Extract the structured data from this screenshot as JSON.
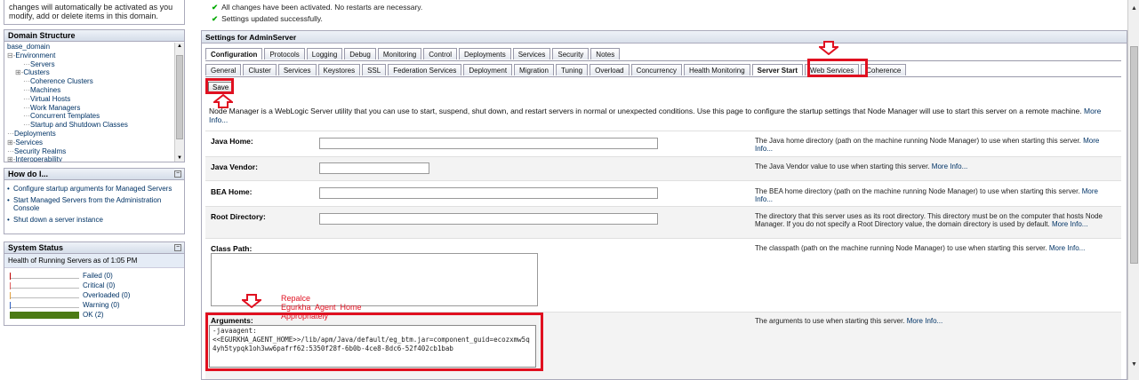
{
  "left": {
    "change_msg": "changes will automatically be activated as you modify, add or delete items in this domain.",
    "domain_structure": {
      "title": "Domain Structure",
      "items": [
        {
          "label": "base_domain",
          "indent": 0,
          "prefix": ""
        },
        {
          "label": "Environment",
          "indent": 0,
          "prefix": "⊟-"
        },
        {
          "label": "Servers",
          "indent": 2,
          "prefix": "···"
        },
        {
          "label": "Clusters",
          "indent": 1,
          "prefix": "⊞-"
        },
        {
          "label": "Coherence Clusters",
          "indent": 2,
          "prefix": "···"
        },
        {
          "label": "Machines",
          "indent": 2,
          "prefix": "···"
        },
        {
          "label": "Virtual Hosts",
          "indent": 2,
          "prefix": "···"
        },
        {
          "label": "Work Managers",
          "indent": 2,
          "prefix": "···"
        },
        {
          "label": "Concurrent Templates",
          "indent": 2,
          "prefix": "···"
        },
        {
          "label": "Startup and Shutdown Classes",
          "indent": 2,
          "prefix": "···"
        },
        {
          "label": "Deployments",
          "indent": 0,
          "prefix": "···"
        },
        {
          "label": "Services",
          "indent": 0,
          "prefix": "⊞-"
        },
        {
          "label": "Security Realms",
          "indent": 0,
          "prefix": "···"
        },
        {
          "label": "Interoperability",
          "indent": 0,
          "prefix": "⊞-"
        }
      ]
    },
    "how_do_i": {
      "title": "How do I...",
      "links": [
        "Configure startup arguments for Managed Servers",
        "Start Managed Servers from the Administration Console",
        "Shut down a server instance"
      ]
    },
    "system_status": {
      "title": "System Status",
      "health_label": "Health of Running Servers as of  1:05 PM",
      "rows": [
        {
          "label": "Failed (0)",
          "color": "#c00000",
          "fill": 0
        },
        {
          "label": "Critical (0)",
          "color": "#e06060",
          "fill": 0
        },
        {
          "label": "Overloaded (0)",
          "color": "#e0a040",
          "fill": 0
        },
        {
          "label": "Warning (0)",
          "color": "#3060c0",
          "fill": 0
        },
        {
          "label": "OK (2)",
          "color": "#4b7a14",
          "fill": 1
        }
      ]
    }
  },
  "main": {
    "notices": [
      "All changes have been activated. No restarts are necessary.",
      "Settings updated successfully."
    ],
    "settings_title": "Settings for AdminServer",
    "tabs_top": [
      "Configuration",
      "Protocols",
      "Logging",
      "Debug",
      "Monitoring",
      "Control",
      "Deployments",
      "Services",
      "Security",
      "Notes"
    ],
    "tabs_sub": [
      "General",
      "Cluster",
      "Services",
      "Keystores",
      "SSL",
      "Federation Services",
      "Deployment",
      "Migration",
      "Tuning",
      "Overload",
      "Concurrency",
      "Health Monitoring",
      "Server Start",
      "Web Services",
      "Coherence"
    ],
    "save_label": "Save",
    "description": "Node Manager is a WebLogic Server utility that you can use to start, suspend, shut down, and restart servers in normal or unexpected conditions. Use this page to configure the startup settings that Node Manager will use to start this server on a remote machine.",
    "more_info": "More Info...",
    "fields": [
      {
        "label": "Java Home:",
        "value": "",
        "help": "The Java home directory (path on the machine running Node Manager) to use when starting this server."
      },
      {
        "label": "Java Vendor:",
        "value": "",
        "help": "The Java Vendor value to use when starting this server."
      },
      {
        "label": "BEA Home:",
        "value": "",
        "help": "The BEA home directory (path on the machine running Node Manager) to use when starting this server."
      },
      {
        "label": "Root Directory:",
        "value": "",
        "help": "The directory that this server uses as its root directory. This directory must be on the computer that hosts Node Manager. If you do not specify a Root Directory value, the domain directory is used by default."
      },
      {
        "label": "Class Path:",
        "value": "",
        "help": "The classpath (path on the machine running Node Manager) to use when starting this server."
      },
      {
        "label": "Arguments:",
        "value": "-javaagent:\n<<EGURKHA_AGENT_HOME>>/lib/apm/Java/default/eg_btm.jar=component_guid=ecozxmw5q4yh5typqk1oh3ww6pafrf62:5350f28f-6b0b-4ce8-8dc6-52f402cb1bab",
        "help": "The arguments to use when starting this server."
      }
    ],
    "annotation": "Repalce\nEgurkha  Agent  Home\nAppropriately"
  },
  "colors": {
    "accent_red": "#e01020",
    "ok_green": "#4b7a14",
    "link": "#003366"
  }
}
